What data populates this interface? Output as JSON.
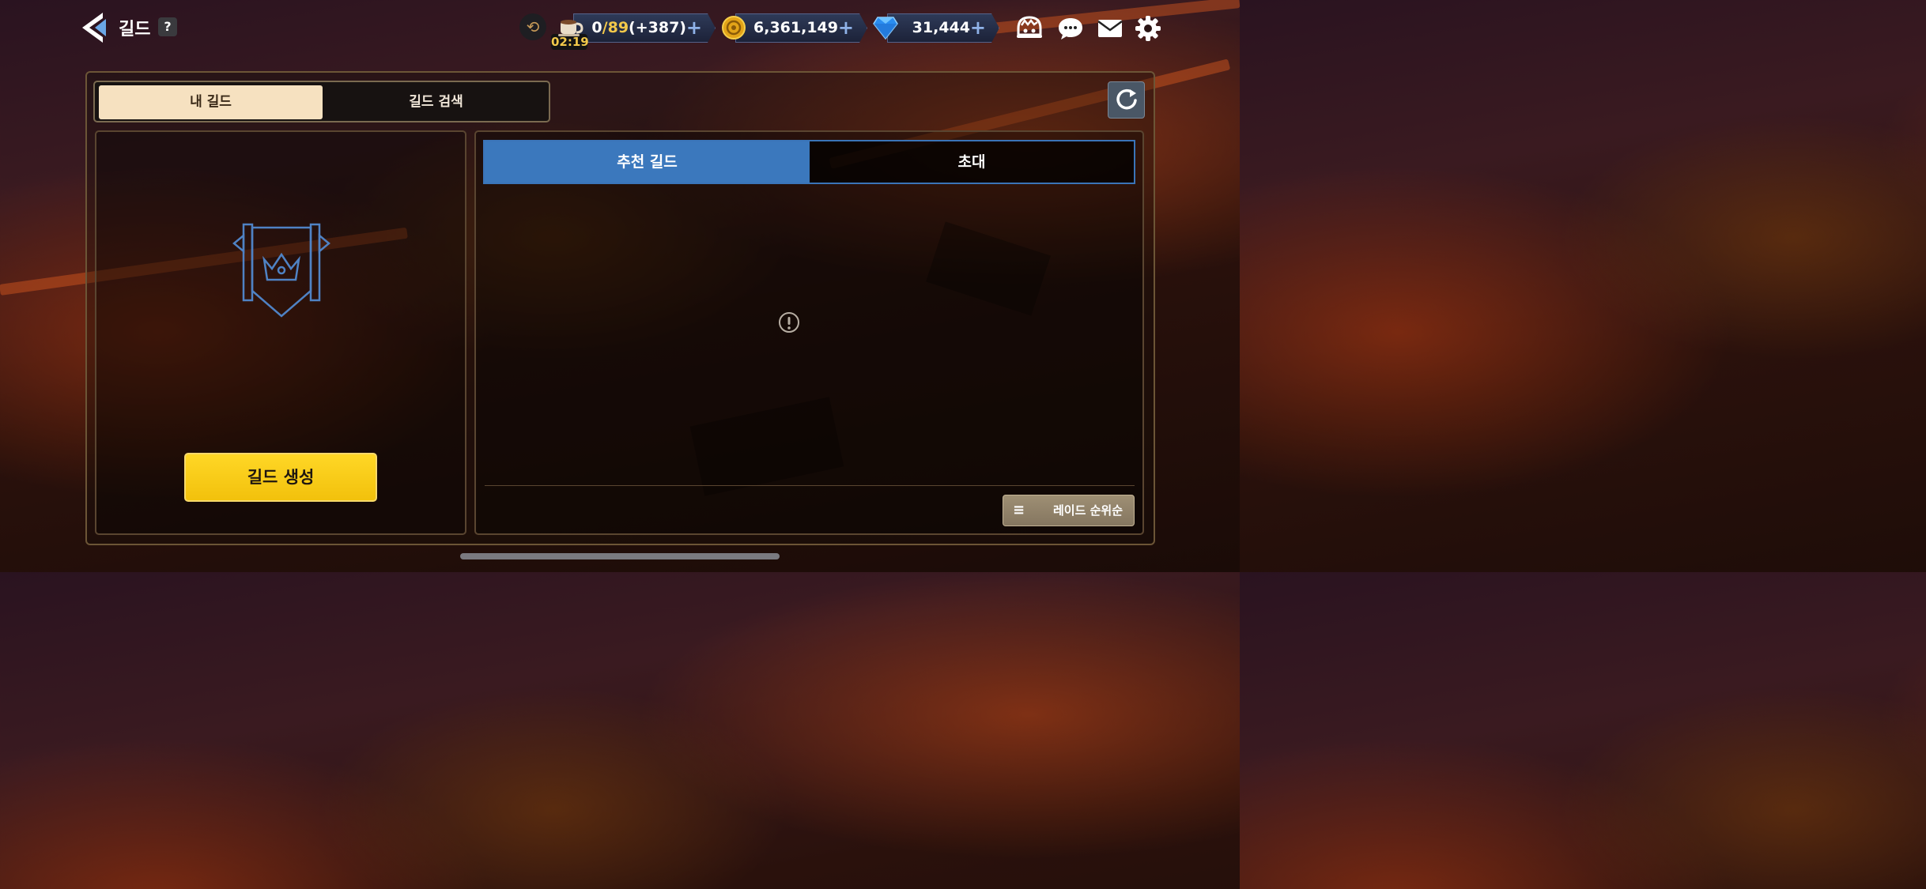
{
  "header": {
    "title": "길드",
    "help_label": "?"
  },
  "resources": {
    "stamina": {
      "current": "0",
      "max": "/89",
      "bonus": "(+387)",
      "timer": "02:19"
    },
    "gold": {
      "value": "6,361,149"
    },
    "gems": {
      "value": "31,444"
    },
    "plus_label": "+"
  },
  "tabs": {
    "my_guild": "내 길드",
    "guild_search": "길드 검색"
  },
  "left_panel": {
    "create_button": "길드 생성"
  },
  "right_panel": {
    "tabs": [
      "추천 길드",
      "초대"
    ],
    "sort_label": "레이드 순위순",
    "sort_icon": "≡"
  },
  "colors": {
    "accent_blue": "#3b78bd",
    "gold_button": "#ffd726",
    "tab_active": "#f6e1c0"
  }
}
